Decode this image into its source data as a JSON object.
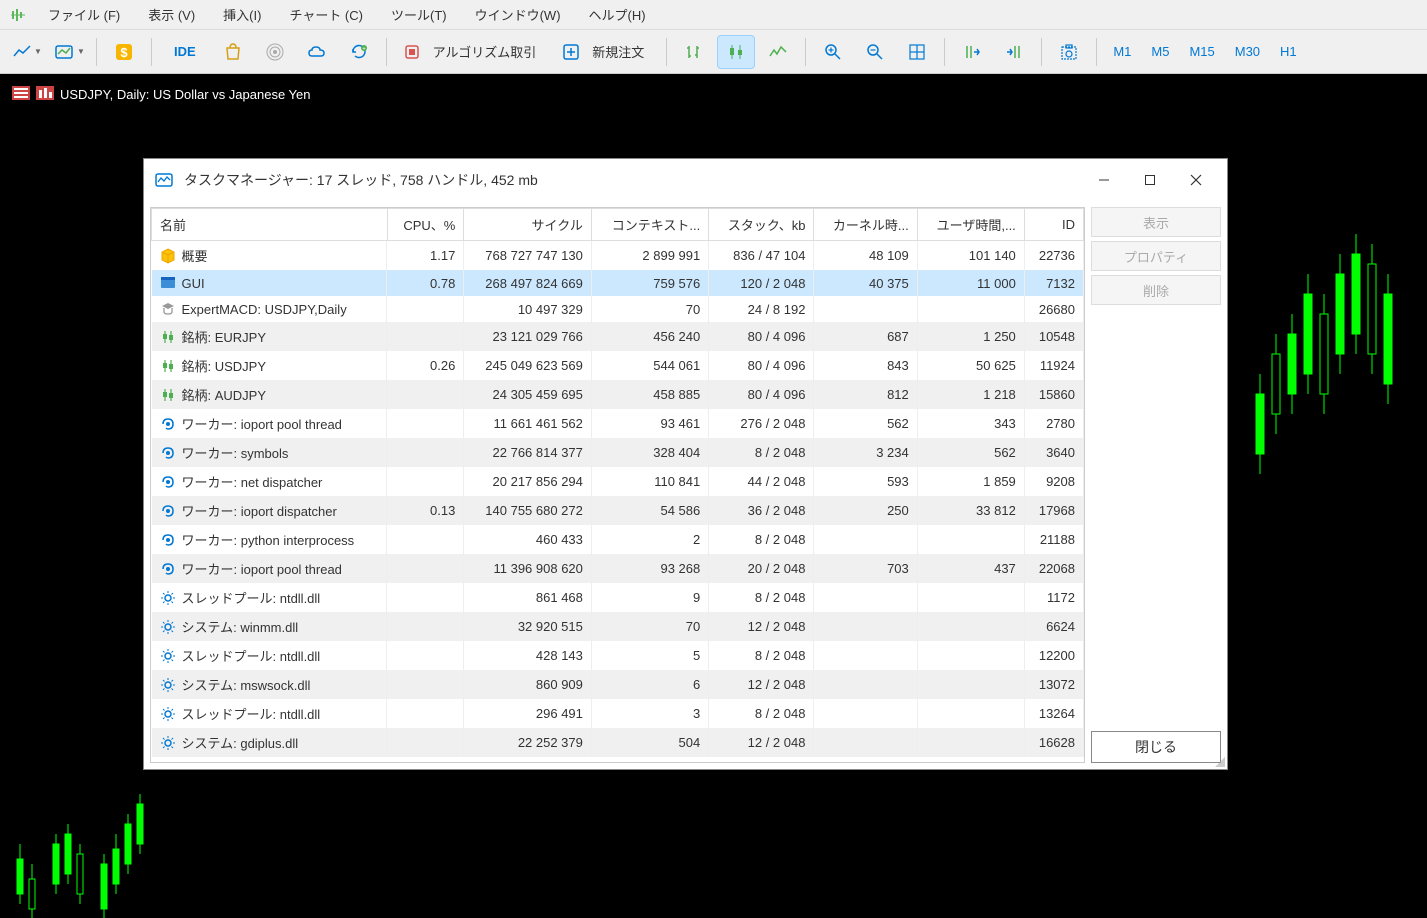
{
  "menu": {
    "file": "ファイル (F)",
    "view": "表示 (V)",
    "insert": "挿入(I)",
    "chart": "チャート (C)",
    "tool": "ツール(T)",
    "window": "ウインドウ(W)",
    "help": "ヘルプ(H)"
  },
  "toolbar": {
    "ide": "IDE",
    "algo": "アルゴリズム取引",
    "neworder": "新規注文",
    "tf": {
      "m1": "M1",
      "m5": "M5",
      "m15": "M15",
      "m30": "M30",
      "h1": "H1"
    }
  },
  "chart": {
    "title": "USDJPY, Daily:  US Dollar vs Japanese Yen"
  },
  "dialog": {
    "title": "タスクマネージャー: 17 スレッド, 758 ハンドル, 452 mb",
    "sidebtns": {
      "show": "表示",
      "props": "プロパティ",
      "delete": "削除"
    },
    "close": "閉じる",
    "headers": [
      "名前",
      "CPU、%",
      "サイクル",
      "コンテキスト...",
      "スタック、kb",
      "カーネル時...",
      "ユーザ時間,...",
      "ID"
    ],
    "rows": [
      {
        "icon": "cube",
        "name": "概要",
        "cpu": "1.17",
        "cycles": "768 727 747 130",
        "ctx": "2 899 991",
        "stack": "836 / 47 104",
        "ktime": "48 109",
        "utime": "101 140",
        "id": "22736",
        "odd": false,
        "sel": false
      },
      {
        "icon": "gui",
        "name": "GUI",
        "cpu": "0.78",
        "cycles": "268 497 824 669",
        "ctx": "759 576",
        "stack": "120 / 2 048",
        "ktime": "40 375",
        "utime": "11 000",
        "id": "7132",
        "odd": false,
        "sel": true
      },
      {
        "icon": "expert",
        "name": "ExpertMACD: USDJPY,Daily",
        "cpu": "",
        "cycles": "10 497 329",
        "ctx": "70",
        "stack": "24 / 8 192",
        "ktime": "",
        "utime": "",
        "id": "26680",
        "odd": false,
        "sel": false
      },
      {
        "icon": "symbol",
        "name": "銘柄: EURJPY",
        "cpu": "",
        "cycles": "23 121 029 766",
        "ctx": "456 240",
        "stack": "80 / 4 096",
        "ktime": "687",
        "utime": "1 250",
        "id": "10548",
        "odd": true,
        "sel": false
      },
      {
        "icon": "symbol",
        "name": "銘柄: USDJPY",
        "cpu": "0.26",
        "cycles": "245 049 623 569",
        "ctx": "544 061",
        "stack": "80 / 4 096",
        "ktime": "843",
        "utime": "50 625",
        "id": "11924",
        "odd": false,
        "sel": false
      },
      {
        "icon": "symbol",
        "name": "銘柄: AUDJPY",
        "cpu": "",
        "cycles": "24 305 459 695",
        "ctx": "458 885",
        "stack": "80 / 4 096",
        "ktime": "812",
        "utime": "1 218",
        "id": "15860",
        "odd": true,
        "sel": false
      },
      {
        "icon": "worker",
        "name": "ワーカー: ioport pool thread",
        "cpu": "",
        "cycles": "11 661 461 562",
        "ctx": "93 461",
        "stack": "276 / 2 048",
        "ktime": "562",
        "utime": "343",
        "id": "2780",
        "odd": false,
        "sel": false
      },
      {
        "icon": "worker",
        "name": "ワーカー: symbols",
        "cpu": "",
        "cycles": "22 766 814 377",
        "ctx": "328 404",
        "stack": "8 / 2 048",
        "ktime": "3 234",
        "utime": "562",
        "id": "3640",
        "odd": true,
        "sel": false
      },
      {
        "icon": "worker",
        "name": "ワーカー: net dispatcher",
        "cpu": "",
        "cycles": "20 217 856 294",
        "ctx": "110 841",
        "stack": "44 / 2 048",
        "ktime": "593",
        "utime": "1 859",
        "id": "9208",
        "odd": false,
        "sel": false
      },
      {
        "icon": "worker",
        "name": "ワーカー: ioport dispatcher",
        "cpu": "0.13",
        "cycles": "140 755 680 272",
        "ctx": "54 586",
        "stack": "36 / 2 048",
        "ktime": "250",
        "utime": "33 812",
        "id": "17968",
        "odd": true,
        "sel": false
      },
      {
        "icon": "worker",
        "name": "ワーカー: python interprocess",
        "cpu": "",
        "cycles": "460 433",
        "ctx": "2",
        "stack": "8 / 2 048",
        "ktime": "",
        "utime": "",
        "id": "21188",
        "odd": false,
        "sel": false
      },
      {
        "icon": "worker",
        "name": "ワーカー: ioport pool thread",
        "cpu": "",
        "cycles": "11 396 908 620",
        "ctx": "93 268",
        "stack": "20 / 2 048",
        "ktime": "703",
        "utime": "437",
        "id": "22068",
        "odd": true,
        "sel": false
      },
      {
        "icon": "gear",
        "name": "スレッドプール: ntdll.dll",
        "cpu": "",
        "cycles": "861 468",
        "ctx": "9",
        "stack": "8 / 2 048",
        "ktime": "",
        "utime": "",
        "id": "1172",
        "odd": false,
        "sel": false
      },
      {
        "icon": "gear",
        "name": "システム: winmm.dll",
        "cpu": "",
        "cycles": "32 920 515",
        "ctx": "70",
        "stack": "12 / 2 048",
        "ktime": "",
        "utime": "",
        "id": "6624",
        "odd": true,
        "sel": false
      },
      {
        "icon": "gear",
        "name": "スレッドプール: ntdll.dll",
        "cpu": "",
        "cycles": "428 143",
        "ctx": "5",
        "stack": "8 / 2 048",
        "ktime": "",
        "utime": "",
        "id": "12200",
        "odd": false,
        "sel": false
      },
      {
        "icon": "gear",
        "name": "システム: mswsock.dll",
        "cpu": "",
        "cycles": "860 909",
        "ctx": "6",
        "stack": "12 / 2 048",
        "ktime": "",
        "utime": "",
        "id": "13072",
        "odd": true,
        "sel": false
      },
      {
        "icon": "gear",
        "name": "スレッドプール: ntdll.dll",
        "cpu": "",
        "cycles": "296 491",
        "ctx": "3",
        "stack": "8 / 2 048",
        "ktime": "",
        "utime": "",
        "id": "13264",
        "odd": false,
        "sel": false
      },
      {
        "icon": "gear",
        "name": "システム: gdiplus.dll",
        "cpu": "",
        "cycles": "22 252 379",
        "ctx": "504",
        "stack": "12 / 2 048",
        "ktime": "",
        "utime": "",
        "id": "16628",
        "odd": true,
        "sel": false
      }
    ]
  }
}
